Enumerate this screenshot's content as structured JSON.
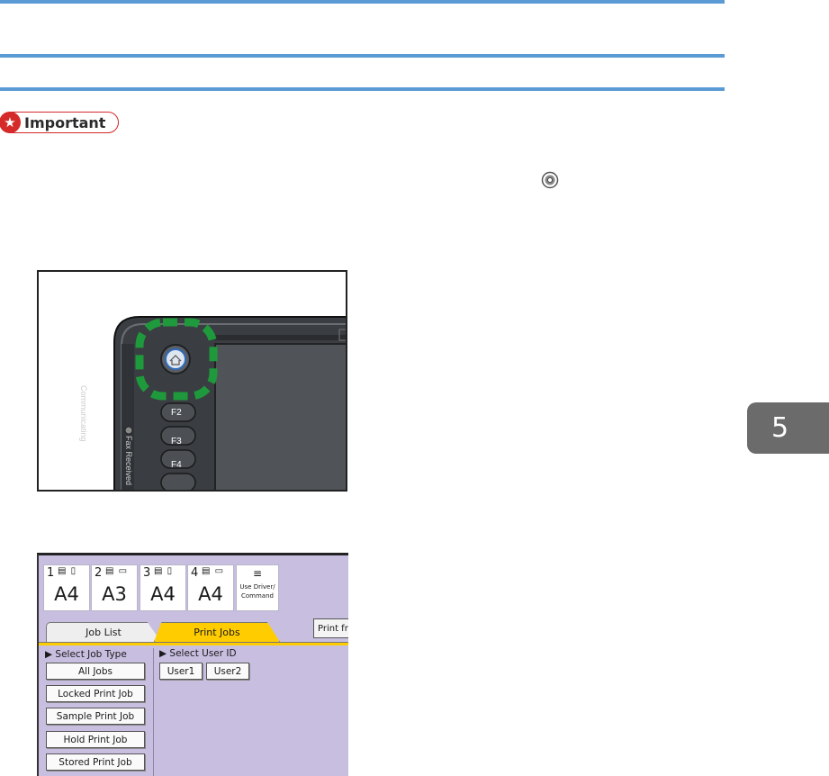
{
  "important_label": "Important",
  "chapter_number": "5",
  "panel_keys": {
    "f2": "F2",
    "f3": "F3",
    "f4": "F4",
    "indicator_communicating": "Communicating",
    "indicator_fax_received": "Fax Received"
  },
  "screen": {
    "trays": [
      {
        "num": "1",
        "size": "A4"
      },
      {
        "num": "2",
        "size": "A3"
      },
      {
        "num": "3",
        "size": "A4"
      },
      {
        "num": "4",
        "size": "A4"
      }
    ],
    "use_driver": "Use Driver/ Command",
    "tabs": {
      "job_list": "Job List",
      "print_jobs": "Print Jobs"
    },
    "print_from": "Print fro",
    "select_job_type": "▶ Select Job Type",
    "select_user_id": "▶ Select User ID",
    "job_type_buttons": [
      "All Jobs",
      "Locked Print Job",
      "Sample Print Job",
      "Hold Print Job",
      "Stored Print Job"
    ],
    "user_buttons": [
      "User1",
      "User2"
    ]
  },
  "colors": {
    "rule": "#5b9bd5",
    "important_red": "#d42a2a",
    "highlight_green": "#1e9a3c",
    "screen_bg": "#c8bfe0",
    "tab_active": "#ffcc00",
    "chapter_tab": "#6b6b6b"
  }
}
